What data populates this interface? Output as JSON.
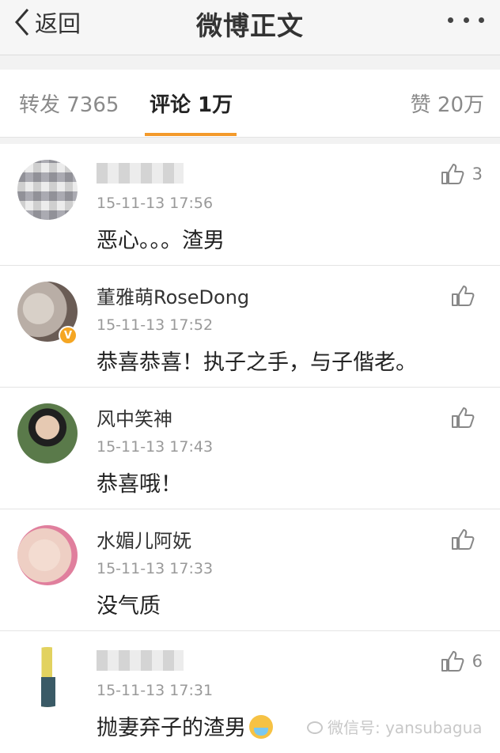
{
  "navbar": {
    "back_label": "返回",
    "title": "微博正文",
    "more_icon": "more-dots-icon"
  },
  "tabs": {
    "repost": "转发 7365",
    "comment": "评论 1万",
    "like": "赞 20万",
    "active": "comment",
    "accent_color": "#f39a2b"
  },
  "comments": [
    {
      "name": "",
      "name_blurred": true,
      "time": "15-11-13 17:56",
      "text": "恶心。。。渣男",
      "likes": "3",
      "verified": false
    },
    {
      "name": "董雅萌RoseDong",
      "name_blurred": false,
      "time": "15-11-13 17:52",
      "text": "恭喜恭喜！执子之手，与子偕老。",
      "likes": "",
      "verified": true
    },
    {
      "name": "风中笑神",
      "name_blurred": false,
      "time": "15-11-13 17:43",
      "text": "恭喜哦！",
      "likes": "",
      "verified": false
    },
    {
      "name": "水媚儿阿妩",
      "name_blurred": false,
      "time": "15-11-13 17:33",
      "text": "没气质",
      "likes": "",
      "verified": false
    },
    {
      "name": "",
      "name_blurred": true,
      "time": "15-11-13 17:31",
      "text": "抛妻弃子的渣男",
      "likes": "6",
      "verified": false
    }
  ],
  "watermark": "微信号: yansubagua"
}
